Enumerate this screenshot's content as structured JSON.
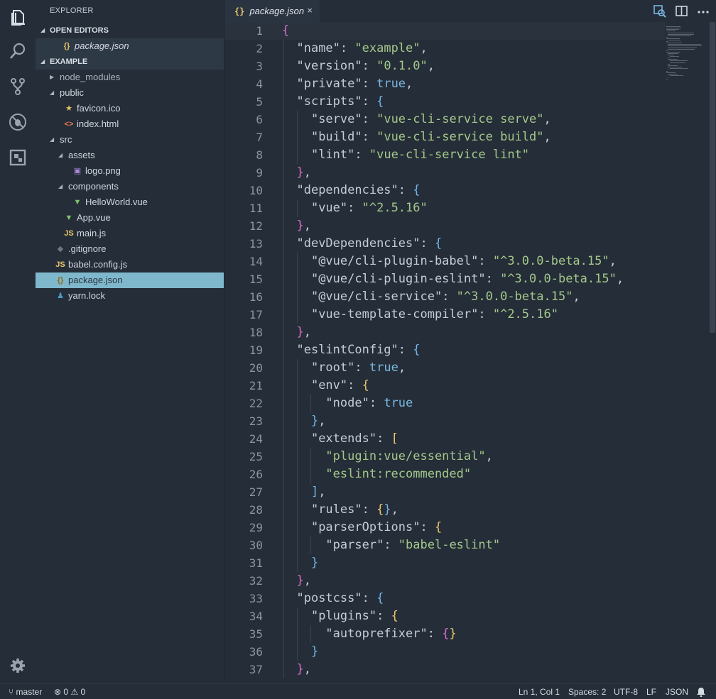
{
  "sidebar": {
    "title": "EXPLORER",
    "open_editors_label": "OPEN EDITORS",
    "open_editor_file": "package.json",
    "project_label": "EXAMPLE",
    "tree": [
      {
        "label": "node_modules",
        "kind": "folder-closed",
        "depth": 0
      },
      {
        "label": "public",
        "kind": "folder-open",
        "depth": 0
      },
      {
        "label": "favicon.ico",
        "kind": "star",
        "depth": 1
      },
      {
        "label": "index.html",
        "kind": "html",
        "depth": 1
      },
      {
        "label": "src",
        "kind": "folder-open",
        "depth": 0
      },
      {
        "label": "assets",
        "kind": "folder-open",
        "depth": 1
      },
      {
        "label": "logo.png",
        "kind": "image",
        "depth": 2
      },
      {
        "label": "components",
        "kind": "folder-open",
        "depth": 1
      },
      {
        "label": "HelloWorld.vue",
        "kind": "vue",
        "depth": 2
      },
      {
        "label": "App.vue",
        "kind": "vue",
        "depth": 1
      },
      {
        "label": "main.js",
        "kind": "js",
        "depth": 1
      },
      {
        "label": ".gitignore",
        "kind": "git",
        "depth": 0
      },
      {
        "label": "babel.config.js",
        "kind": "js",
        "depth": 0
      },
      {
        "label": "package.json",
        "kind": "json",
        "depth": 0
      },
      {
        "label": "yarn.lock",
        "kind": "yarn",
        "depth": 0
      }
    ]
  },
  "tab": {
    "label": "package.json",
    "close": "×"
  },
  "icons": {
    "activity": [
      "files-icon",
      "search-icon",
      "source-control-icon",
      "debug-icon",
      "extensions-icon",
      "settings-gear-icon"
    ],
    "accent": "#7fb8cc"
  },
  "code": [
    "{",
    "  \"name\": \"example\",",
    "  \"version\": \"0.1.0\",",
    "  \"private\": true,",
    "  \"scripts\": {",
    "    \"serve\": \"vue-cli-service serve\",",
    "    \"build\": \"vue-cli-service build\",",
    "    \"lint\": \"vue-cli-service lint\"",
    "  },",
    "  \"dependencies\": {",
    "    \"vue\": \"^2.5.16\"",
    "  },",
    "  \"devDependencies\": {",
    "    \"@vue/cli-plugin-babel\": \"^3.0.0-beta.15\",",
    "    \"@vue/cli-plugin-eslint\": \"^3.0.0-beta.15\",",
    "    \"@vue/cli-service\": \"^3.0.0-beta.15\",",
    "    \"vue-template-compiler\": \"^2.5.16\"",
    "  },",
    "  \"eslintConfig\": {",
    "    \"root\": true,",
    "    \"env\": {",
    "      \"node\": true",
    "    },",
    "    \"extends\": [",
    "      \"plugin:vue/essential\",",
    "      \"eslint:recommended\"",
    "    ],",
    "    \"rules\": {},",
    "    \"parserOptions\": {",
    "      \"parser\": \"babel-eslint\"",
    "    }",
    "  },",
    "  \"postcss\": {",
    "    \"plugins\": {",
    "      \"autoprefixer\": {}",
    "    }",
    "  },"
  ],
  "status": {
    "branch": "master",
    "errors": "0",
    "warnings": "0",
    "position": "Ln 1, Col 1",
    "spaces": "Spaces: 2",
    "encoding": "UTF-8",
    "eol": "LF",
    "language": "JSON"
  }
}
